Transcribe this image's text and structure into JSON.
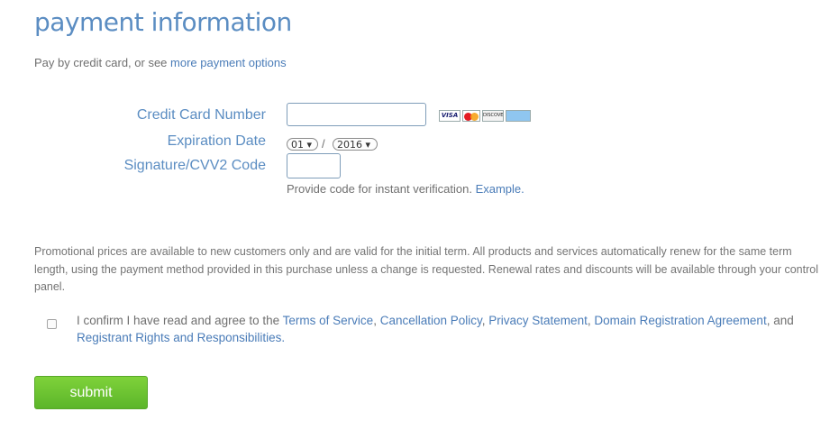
{
  "title": "payment information",
  "subtitle": {
    "prefix": "Pay by credit card, or see ",
    "link": "more payment options"
  },
  "form": {
    "cc_label": "Credit Card Number",
    "cc_value": "",
    "exp_label": "Expiration Date",
    "exp_month": "01",
    "exp_separator": "/",
    "exp_year": "2016",
    "cvv_label": "Signature/CVV2 Code",
    "cvv_value": "",
    "hint_text": "Provide code for instant verification. ",
    "hint_link": "Example."
  },
  "card_logos": [
    "visa-logo",
    "mastercard-logo",
    "discover-logo",
    "amex-logo"
  ],
  "card_logo_text": {
    "visa": "VISA",
    "discover": "DISCOVER"
  },
  "promo_text": "Promotional prices are available to new customers only and are valid for the initial term. All products and services automatically renew for the same term length, using the payment method provided in this purchase unless a change is requested. Renewal rates and discounts will be available through your control panel.",
  "confirm": {
    "checked": false,
    "prefix": "I confirm I have read and agree to the ",
    "links": [
      "Terms of Service",
      "Cancellation Policy",
      "Privacy Statement",
      "Domain Registration Agreement",
      "Registrant Rights and Responsibilities."
    ],
    "sep1": ", ",
    "sep2": ", ",
    "sep3": ", ",
    "sep4": ", and "
  },
  "submit_label": "submit",
  "colors": {
    "heading_blue": "#5b8dc2",
    "link_blue": "#4a7cb8",
    "submit_green": "#6cc432"
  }
}
